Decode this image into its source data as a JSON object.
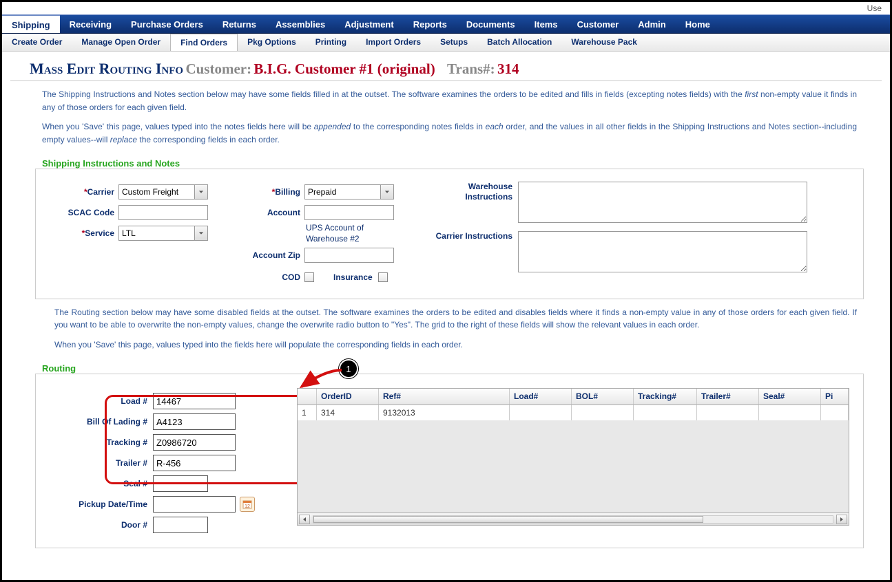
{
  "topRight": "Use",
  "navPrimary": {
    "active": "Shipping",
    "items": [
      "Shipping",
      "Receiving",
      "Purchase Orders",
      "Returns",
      "Assemblies",
      "Adjustment",
      "Reports",
      "Documents",
      "Items",
      "Customer",
      "Admin",
      "Home"
    ]
  },
  "navSecondary": {
    "active": "Find Orders",
    "items": [
      "Create Order",
      "Manage Open Order",
      "Find Orders",
      "Pkg Options",
      "Printing",
      "Import Orders",
      "Setups",
      "Batch Allocation",
      "Warehouse Pack"
    ]
  },
  "heading": {
    "title": "Mass Edit Routing Info",
    "customerLabel": "Customer:",
    "customerName": "B.I.G. Customer #1 (original)",
    "transLabel": "Trans#:",
    "transVal": "314"
  },
  "intro1a": "The Shipping Instructions and Notes section below may have some fields filled in at the outset. The software examines the orders to be edited and fills in fields (excepting notes fields) with the ",
  "intro1b": "first",
  "intro1c": " non-empty value it finds in any of those orders for each given field.",
  "intro2a": "When you 'Save' this page, values typed into the notes fields here will be ",
  "intro2b": "appended",
  "intro2c": " to the corresponding notes fields in ",
  "intro2d": "each",
  "intro2e": " order, and the values in all other fields in the Shipping Instructions and Notes section--including empty values--will ",
  "intro2f": "replace",
  "intro2g": " the corresponding fields in each order.",
  "shipSection": {
    "title": "Shipping Instructions and Notes",
    "carrierLabel": "Carrier",
    "carrierValue": "Custom Freight",
    "scacLabel": "SCAC Code",
    "scacValue": "",
    "serviceLabel": "Service",
    "serviceValue": "LTL",
    "billingLabel": "Billing",
    "billingValue": "Prepaid",
    "accountLabel": "Account",
    "accountValue": "",
    "accountNote1": "UPS Account of",
    "accountNote2": "Warehouse #2",
    "accountZipLabel": "Account Zip",
    "accountZipValue": "",
    "codLabel": "COD",
    "insuranceLabel": "Insurance",
    "whInstrLabel": "Warehouse Instructions",
    "whInstrValue": "",
    "carInstrLabel": "Carrier Instructions",
    "carInstrValue": ""
  },
  "intro3": "The Routing section below may have some disabled fields at the outset. The software examines the orders to be edited and disables fields where it finds a non-empty value in any of those orders for each given field. If you want to be able to overwrite the non-empty values, change the overwrite radio button to \"Yes\". The grid to the right of these fields will show the relevant values in each order.",
  "intro4": "When you 'Save' this page, values typed into the fields here will populate the corresponding fields in each order.",
  "routing": {
    "title": "Routing",
    "callout": "1",
    "fields": {
      "loadLabel": "Load #",
      "loadValue": "14467",
      "bolLabel": "Bill Of Lading #",
      "bolValue": "A4123",
      "trackingLabel": "Tracking #",
      "trackingValue": "Z0986720",
      "trailerLabel": "Trailer #",
      "trailerValue": "R-456",
      "sealLabel": "Seal #",
      "sealValue": "",
      "pickupLabel": "Pickup Date/Time",
      "pickupValue": "",
      "doorLabel": "Door #",
      "doorValue": ""
    },
    "grid": {
      "columns": [
        "",
        "OrderID",
        "Ref#",
        "Load#",
        "BOL#",
        "Tracking#",
        "Trailer#",
        "Seal#",
        "Pi"
      ],
      "widths": [
        28,
        90,
        190,
        90,
        90,
        92,
        90,
        90,
        40
      ],
      "rows": [
        {
          "n": "1",
          "OrderID": "314",
          "Ref#": "9132013",
          "Load#": "",
          "BOL#": "",
          "Tracking#": "",
          "Trailer#": "",
          "Seal#": "",
          "Pi": ""
        }
      ]
    }
  }
}
